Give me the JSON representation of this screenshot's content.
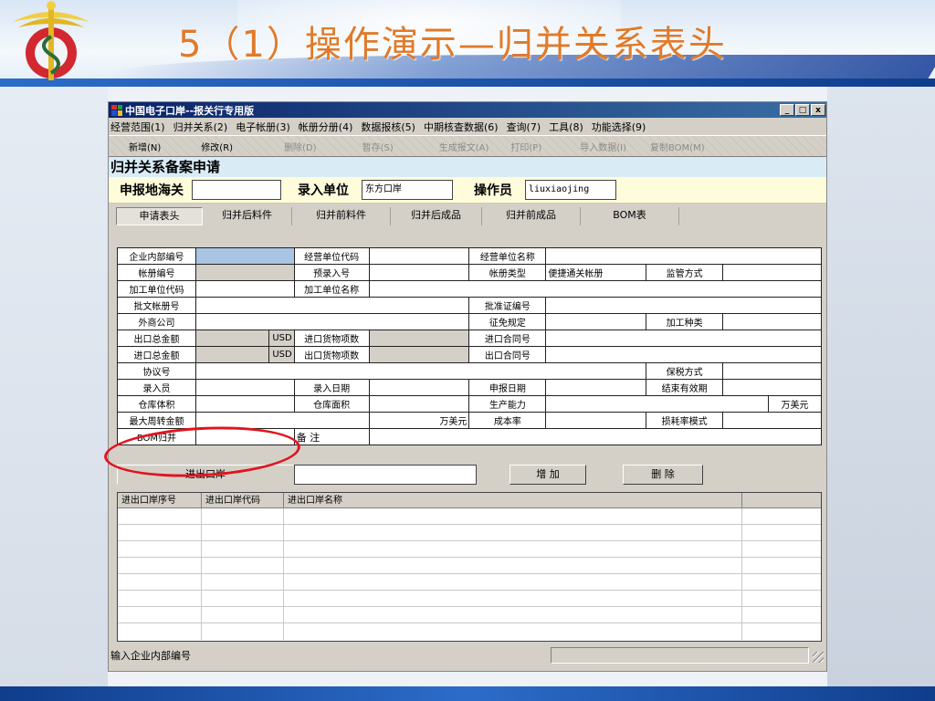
{
  "slide": {
    "title": "5（1）操作演示—归并关系表头",
    "accent_color": "#e07a2a",
    "logo_icon": "customs-caduceus-icon"
  },
  "window": {
    "title": "中国电子口岸--报关行专用版",
    "controls": [
      "_",
      "□",
      "x"
    ]
  },
  "menu": [
    "经营范围(1)",
    "归并关系(2)",
    "电子帐册(3)",
    "帐册分册(4)",
    "数据报核(5)",
    "中期核查数据(6)",
    "查询(7)",
    "工具(8)",
    "功能选择(9)"
  ],
  "toolbar": [
    {
      "label": "新增(N)",
      "enabled": true
    },
    {
      "label": "修改(R)",
      "enabled": true
    },
    {
      "label": "删除(D)",
      "enabled": false
    },
    {
      "label": "暂存(S)",
      "enabled": false
    },
    {
      "label": "生成报文(A)",
      "enabled": false
    },
    {
      "label": "打印(P)",
      "enabled": false
    },
    {
      "label": "导入数据(I)",
      "enabled": false
    },
    {
      "label": "复制BOM(M)",
      "enabled": false
    }
  ],
  "form": {
    "title": "归并关系备案申请",
    "declare_customs_label": "申报地海关",
    "declare_customs_value": "",
    "entry_unit_label": "录入单位",
    "entry_unit_value": "东方口岸",
    "operator_label": "操作员",
    "operator_value": "liuxiaojing"
  },
  "tabs": [
    "申请表头",
    "归并后料件",
    "归并前料件",
    "归并后成品",
    "归并前成品",
    "BOM表"
  ],
  "fields": {
    "r1": [
      "企业内部编号",
      "经营单位代码",
      "经营单位名称"
    ],
    "r2": [
      "帐册编号",
      "预录入号",
      "帐册类型",
      "便捷通关帐册",
      "监管方式"
    ],
    "r3": [
      "加工单位代码",
      "加工单位名称"
    ],
    "r4": [
      "批文帐册号",
      "批准证编号"
    ],
    "r5": [
      "外商公司",
      "征免规定",
      "加工种类"
    ],
    "r6": [
      "出口总金额",
      "USD",
      "进口货物项数",
      "进口合同号"
    ],
    "r7": [
      "进口总金额",
      "USD",
      "出口货物项数",
      "出口合同号"
    ],
    "r8": [
      "协议号",
      "保税方式"
    ],
    "r9": [
      "录入员",
      "录入日期",
      "申报日期",
      "结束有效期"
    ],
    "r10": [
      "仓库体积",
      "仓库面积",
      "生产能力",
      "万美元"
    ],
    "r11": [
      "最大周转金额",
      "万美元",
      "成本率",
      "损耗率模式"
    ],
    "r12": [
      "BOM归并",
      "备  注"
    ]
  },
  "port": {
    "label": "进出口岸",
    "add_label": "增 加",
    "delete_label": "删 除"
  },
  "list": {
    "columns": [
      "进出口岸序号",
      "进出口岸代码",
      "进出口岸名称"
    ]
  },
  "status": {
    "hint": "输入企业内部编号"
  }
}
